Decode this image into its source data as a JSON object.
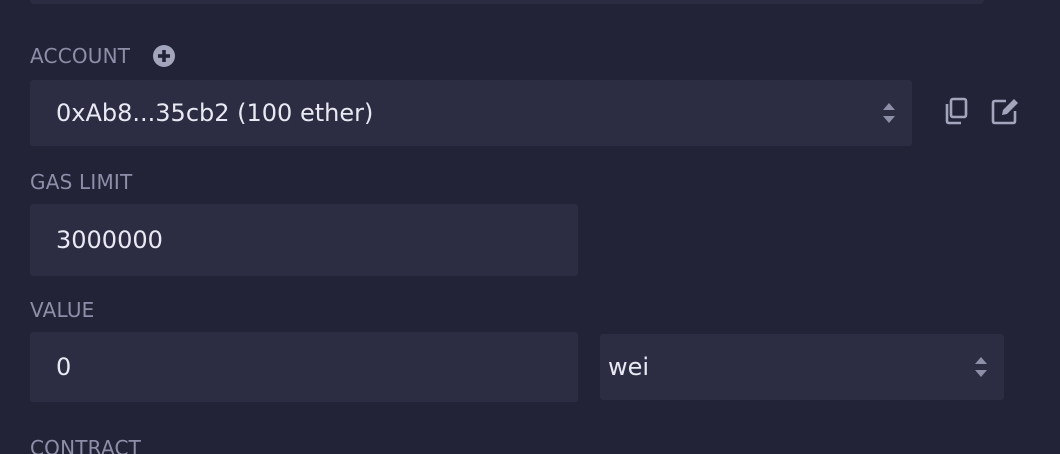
{
  "account": {
    "label": "ACCOUNT",
    "selected": "0xAb8...35cb2 (100 ether)"
  },
  "gas_limit": {
    "label": "GAS LIMIT",
    "value": "3000000"
  },
  "value": {
    "label": "VALUE",
    "amount": "0",
    "unit": "wei"
  },
  "contract": {
    "label": "CONTRACT"
  },
  "icons": {
    "add_account": "plus-circle-icon",
    "copy": "copy-icon",
    "edit": "edit-icon"
  },
  "colors": {
    "background": "#222336",
    "field": "#2c2d42",
    "label": "#8d8fa9",
    "text": "#e8e9f3"
  }
}
